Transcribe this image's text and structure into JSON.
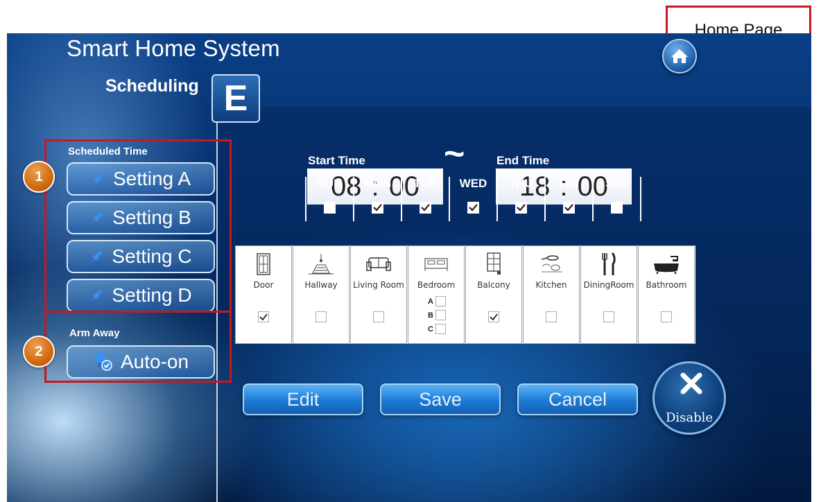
{
  "header": {
    "title": "Smart Home System",
    "section": "Scheduling",
    "badge": "E"
  },
  "home_callout": "Home Page",
  "sidebar": {
    "scheduled_label": "Scheduled Time",
    "settings": [
      {
        "label": "Setting A"
      },
      {
        "label": "Setting B"
      },
      {
        "label": "Setting C"
      },
      {
        "label": "Setting D"
      }
    ],
    "arm_label": "Arm Away",
    "auto_on": "Auto-on"
  },
  "annotations": {
    "one": "1",
    "two": "2"
  },
  "time": {
    "start_label": "Start Time",
    "start_hour": "08",
    "start_min": "00",
    "end_label": "End Time",
    "end_hour": "18",
    "end_min": "00",
    "separator": ":",
    "tilde": "~"
  },
  "days": [
    {
      "name": "SUN",
      "checked": false
    },
    {
      "name": "MON",
      "checked": true
    },
    {
      "name": "TUE",
      "checked": true
    },
    {
      "name": "WED",
      "checked": true
    },
    {
      "name": "THU",
      "checked": true
    },
    {
      "name": "FRI",
      "checked": true
    },
    {
      "name": "SAT",
      "checked": false
    }
  ],
  "rooms": [
    {
      "name": "Door",
      "icon": "door-icon",
      "checked": true
    },
    {
      "name": "Hallway",
      "icon": "hallway-icon",
      "checked": false
    },
    {
      "name": "Living Room",
      "icon": "sofa-icon",
      "checked": false
    },
    {
      "name": "Bedroom",
      "icon": "bed-icon",
      "sub": [
        "A",
        "B",
        "C"
      ]
    },
    {
      "name": "Balcony",
      "icon": "balcony-icon",
      "checked": true
    },
    {
      "name": "Kitchen",
      "icon": "kitchen-icon",
      "checked": false
    },
    {
      "name": "DiningRoom",
      "icon": "dining-icon",
      "checked": false
    },
    {
      "name": "Bathroom",
      "icon": "bathtub-icon",
      "checked": false
    }
  ],
  "actions": {
    "edit": "Edit",
    "save": "Save",
    "cancel": "Cancel",
    "disable": "Disable"
  },
  "colors": {
    "annotation_red": "#c8181e",
    "accent_orange": "#d06a12",
    "button_blue": "#1e7ed8"
  }
}
